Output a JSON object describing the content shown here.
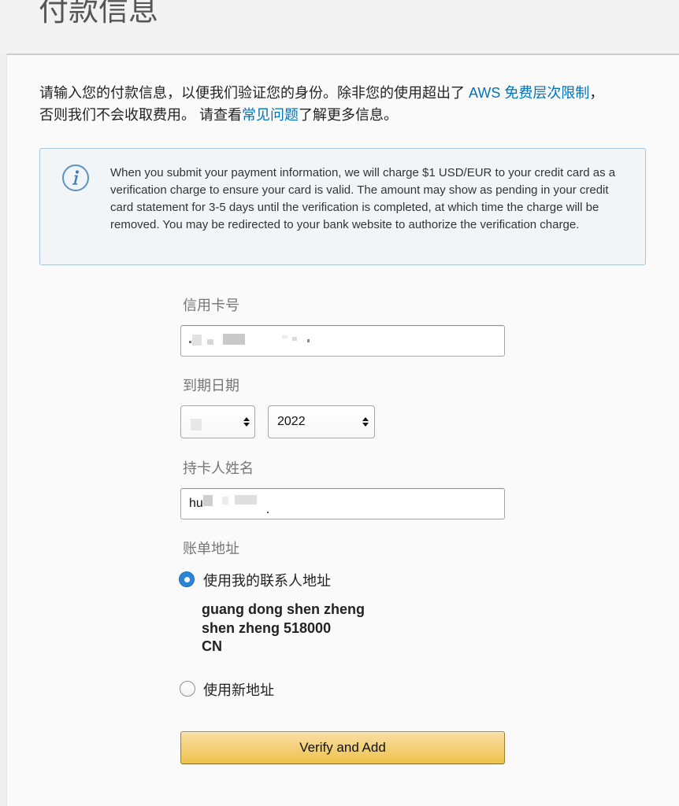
{
  "page": {
    "title": "付款信息"
  },
  "intro": {
    "line1_text": "请输入您的付款信息，以便我们验证您的身份。除非您的使用超出了 ",
    "free_tier_link": "AWS 免费层次限制",
    "line1_end": "，",
    "line2_text": "否则我们不会收取费用。 请查看",
    "faq_link": "常见问题",
    "line2_end": "了解更多信息。"
  },
  "notice": {
    "icon": "info-icon",
    "text": "When you submit your payment information, we will charge $1 USD/EUR to your credit card as a verification charge to ensure your card is valid. The amount may show as pending in your credit card statement for 3-5 days until the verification is completed, at which time the charge will be removed. You may be redirected to your bank website to authorize the verification charge."
  },
  "form": {
    "card_number": {
      "label": "信用卡号"
    },
    "expiration": {
      "label": "到期日期",
      "year": "2022"
    },
    "cardholder": {
      "label": "持卡人姓名",
      "value": "hu"
    },
    "billing": {
      "label": "账单地址",
      "options": [
        {
          "label": "使用我的联系人地址",
          "selected": true
        },
        {
          "label": "使用新地址",
          "selected": false
        }
      ],
      "address_lines": [
        "guang dong shen zheng",
        "shen zheng 518000",
        "CN"
      ]
    },
    "submit_label": "Verify and Add"
  },
  "icons": {
    "notice": "info-icon",
    "select": "updown-arrows-icon"
  },
  "colors": {
    "link": "#0073bb",
    "radio_selected": "#2b87d6",
    "notice_background": "#f1f5f8",
    "notice_border": "#a9c4d6",
    "button_top": "#f7dfa5",
    "button_bottom": "#f0c14b"
  }
}
